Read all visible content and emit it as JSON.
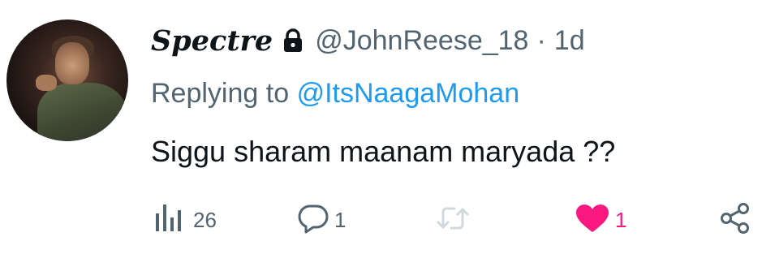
{
  "tweet": {
    "display_name": "Spectre",
    "protected_icon": "lock-icon",
    "handle": "@JohnReese_18",
    "separator": "·",
    "time": "1d",
    "reply_prefix": "Replying to",
    "reply_to": "@ItsNaagaMohan",
    "text": "Siggu sharam maanam maryada ??"
  },
  "actions": {
    "views": {
      "icon": "bar-chart-icon",
      "count": "26"
    },
    "reply": {
      "icon": "speech-bubble-icon",
      "count": "1"
    },
    "retweet": {
      "icon": "retweet-icon",
      "count": ""
    },
    "like": {
      "icon": "heart-icon",
      "count": "1",
      "liked": true
    },
    "share": {
      "icon": "share-icon"
    }
  },
  "colors": {
    "text_primary": "#0f1419",
    "text_secondary": "#536471",
    "link": "#1d9bf0",
    "like": "#f91880",
    "retweet_disabled": "#cfd9de"
  }
}
